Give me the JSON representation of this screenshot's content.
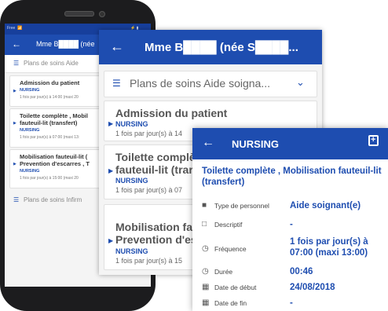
{
  "colors": {
    "primary": "#1e4db0",
    "status_bar": "#173f9c"
  },
  "phone": {
    "status": {
      "carrier": "Free",
      "signal": "📶",
      "time_icons": "⚡ ▮"
    },
    "appbar": {
      "title": "Mme B████ (née"
    },
    "section_soins": "Plans de soins Aide",
    "cards": [
      {
        "title": "Admission du patient",
        "tag": "NURSING",
        "freq": "1 fois par jour(s) à 14:00 (maxi 20"
      },
      {
        "title": "Toilette complète , Mobil",
        "title2": "fauteuil-lit (transfert)",
        "tag": "NURSING",
        "freq": "1 fois par jour(s) à 07:00 (maxi 13:"
      },
      {
        "title": "Mobilisation fauteuil-lit (",
        "title2": "Prevention d'escarres , T",
        "tag": "NURSING",
        "freq": "1 fois par jour(s) à 15:00 (maxi 20"
      }
    ],
    "section_infirm": "Plans de soins Infirm"
  },
  "tablet": {
    "appbar": {
      "title": "Mme B████ (née S████..."
    },
    "section": "Plans de soins Aide soigna...",
    "cards": [
      {
        "title": "Admission du patient",
        "tag": "NURSING",
        "freq": "1 fois par jour(s) à 14"
      },
      {
        "title": "Toilette complè",
        "title2": "fauteuil-lit (trar",
        "tag": "NURSING",
        "freq": "1 fois par jour(s) à 07"
      },
      {
        "title": "Mobilisation fa",
        "title2": "Prevention d'es",
        "tag": "NURSING",
        "freq": "1 fois par jour(s) à 15"
      }
    ]
  },
  "detail": {
    "appbar": {
      "title": "NURSING"
    },
    "title": "Toilette complète , Mobilisation fauteuil-lit (transfert)",
    "rows": [
      {
        "icon": "person-icon",
        "label": "Type de personnel",
        "value": "Aide soignant(e)"
      },
      {
        "icon": "document-icon",
        "label": "Descriptif",
        "value": "-"
      },
      {
        "icon": "clock-icon",
        "label": "Fréquence",
        "value": "1 fois par jour(s) à 07:00 (maxi 13:00)"
      },
      {
        "icon": "clock-icon",
        "label": "Durée",
        "value": "00:46"
      },
      {
        "icon": "calendar-icon",
        "label": "Date de début",
        "value": "24/08/2018"
      },
      {
        "icon": "calendar-icon",
        "label": "Date de fin",
        "value": "-"
      }
    ]
  }
}
